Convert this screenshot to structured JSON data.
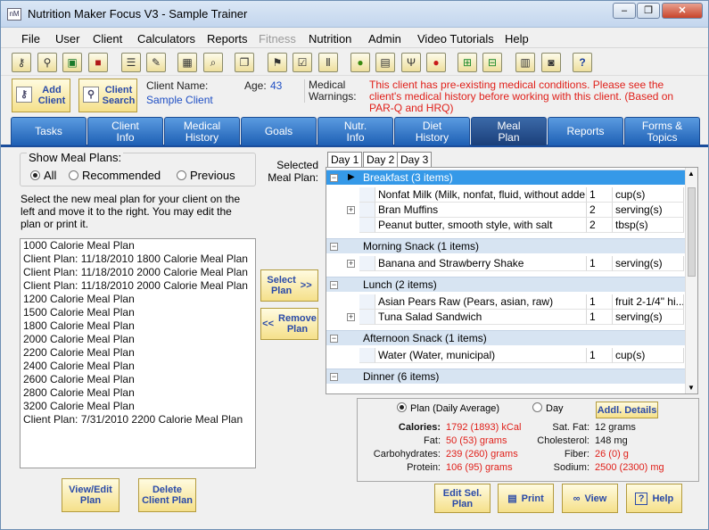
{
  "window": {
    "title": "Nutrition Maker Focus V3 - Sample Trainer",
    "app_icon": "nM",
    "buttons": [
      "–",
      "❐",
      "✕"
    ]
  },
  "menu": [
    "File",
    "User",
    "Client",
    "Calculators",
    "Reports",
    "Fitness",
    "Nutrition",
    "Admin",
    "Video Tutorials",
    "Help"
  ],
  "toolbar_icons": [
    "add-client-icon",
    "search-client-icon",
    "save-icon",
    "exit-icon",
    "checklist-icon",
    "notes-icon",
    "presentation-icon",
    "search-icon",
    "documents-icon",
    "goal-flag-icon",
    "clipboard-icon",
    "dumbbell-icon",
    "apple-icon",
    "food-guide-icon",
    "utensils-icon",
    "tomato-icon",
    "export-icon",
    "import-icon",
    "print-clipboard-icon",
    "camera-icon",
    "help-icon"
  ],
  "header": {
    "add_client": "Add\nClient",
    "client_search": "Client\nSearch",
    "client_name_label": "Client Name:",
    "client_name": "Sample Client",
    "age_label": "Age:",
    "age": "43",
    "med_label": "Medical\nWarnings:",
    "warning": "This client has pre-existing medical conditions. Please see the client's medical history before working with this client.  (Based on PAR-Q and HRQ)"
  },
  "tabs": [
    "Tasks",
    "Client\nInfo",
    "Medical\nHistory",
    "Goals",
    "Nutr.\nInfo",
    "Diet\nHistory",
    "Meal\nPlan",
    "Reports",
    "Forms &\nTopics"
  ],
  "left": {
    "show_label": "Show Meal Plans:",
    "radios": [
      "All",
      "Recommended",
      "Previous"
    ],
    "instructions": "Select the new meal plan for your client on the left and move it to the right.  You may edit the plan or print it.",
    "plans": [
      "1000 Calorie Meal Plan",
      "Client Plan: 11/18/2010 1800 Calorie Meal Plan",
      "Client Plan: 11/18/2010 2000 Calorie Meal Plan",
      "Client Plan: 11/18/2010 2000 Calorie Meal Plan",
      "1200 Calorie Meal Plan",
      "1500 Calorie Meal Plan",
      "1800 Calorie Meal Plan",
      "2000 Calorie Meal Plan",
      "2200 Calorie Meal Plan",
      "2400 Calorie Meal Plan",
      "2600 Calorie Meal Plan",
      "2800 Calorie Meal Plan",
      "3200 Calorie Meal Plan",
      "Client Plan: 7/31/2010 2200 Calorie Meal Plan"
    ],
    "view_edit": "View/Edit\nPlan",
    "delete_plan": "Delete\nClient Plan"
  },
  "middle": {
    "select_plan": "Select\nPlan",
    "select_arrow": ">>",
    "remove_arrow": "<<",
    "remove_plan": "Remove\nPlan",
    "selected_label": "Selected\nMeal Plan:"
  },
  "days": [
    "Day 1",
    "Day 2",
    "Day 3"
  ],
  "meal_groups": [
    {
      "title": "Breakfast (3 items)",
      "items": [
        {
          "name": "Nonfat Milk (Milk, nonfat, fluid, without adde...",
          "qty": "1",
          "unit": "cup(s)",
          "expand": false
        },
        {
          "name": "Bran Muffins",
          "qty": "2",
          "unit": "serving(s)",
          "expand": true
        },
        {
          "name": "Peanut butter, smooth style, with salt",
          "qty": "2",
          "unit": "tbsp(s)",
          "expand": false
        }
      ]
    },
    {
      "title": "Morning Snack (1 items)",
      "items": [
        {
          "name": "Banana and Strawberry Shake",
          "qty": "1",
          "unit": "serving(s)",
          "expand": true
        }
      ]
    },
    {
      "title": "Lunch (2 items)",
      "items": [
        {
          "name": "Asian Pears Raw (Pears, asian, raw)",
          "qty": "1",
          "unit": "fruit 2-1/4\" hi...",
          "expand": false
        },
        {
          "name": "Tuna Salad Sandwich",
          "qty": "1",
          "unit": "serving(s)",
          "expand": true
        }
      ]
    },
    {
      "title": "Afternoon Snack (1 items)",
      "items": [
        {
          "name": "Water (Water, municipal)",
          "qty": "1",
          "unit": "cup(s)",
          "expand": false
        }
      ]
    },
    {
      "title": "Dinner (6 items)",
      "items": []
    }
  ],
  "nutrition": {
    "plan_radio": "Plan (Daily Average)",
    "day_radio": "Day",
    "details": "Addl. Details",
    "calories_label": "Calories:",
    "calories": "1792 (1893) kCal",
    "fat_label": "Fat:",
    "fat": "50 (53) grams",
    "carb_label": "Carbohydrates:",
    "carb": "239 (260) grams",
    "protein_label": "Protein:",
    "protein": "106 (95) grams",
    "satfat_label": "Sat. Fat:",
    "satfat": "12 grams",
    "chol_label": "Cholesterol:",
    "chol": "148 mg",
    "fiber_label": "Fiber:",
    "fiber": "26 (0) g",
    "sodium_label": "Sodium:",
    "sodium": "2500 (2300) mg"
  },
  "bottom": {
    "edit_sel": "Edit Sel.\nPlan",
    "print": "Print",
    "view": "View",
    "help": "Help"
  }
}
